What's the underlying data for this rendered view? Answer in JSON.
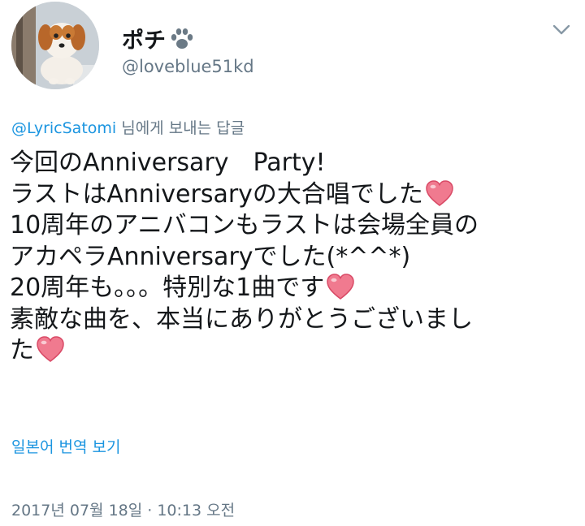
{
  "user": {
    "display_name": "ポチ",
    "handle": "@loveblue51kd",
    "avatar_icon": "puppy-avatar",
    "badge_icon": "paw-print-icon"
  },
  "menu": {
    "icon": "chevron-down-icon"
  },
  "reply": {
    "mention": "@LyricSatomi",
    "suffix": " 님에게 보내는 답글"
  },
  "tweet": {
    "lines": [
      "今回のAnniversary　Party!",
      "ラストはAnniversaryの大合唱でした",
      "10周年のアニバコンもラストは会場全員の",
      "アカペラAnniversaryでした(*^^*)",
      "20周年も。。。特別な1曲です",
      "素敵な曲を、本当にありがとうございまし",
      "た"
    ],
    "emoji_icon": "red-heart-icon"
  },
  "translate_label": "일본어 번역 보기",
  "timestamp": "2017년 07월 18일 · 10:13 오전",
  "colors": {
    "text": "#14171a",
    "secondary": "#657786",
    "link": "#1b95e0",
    "heart": "#e0245e"
  }
}
